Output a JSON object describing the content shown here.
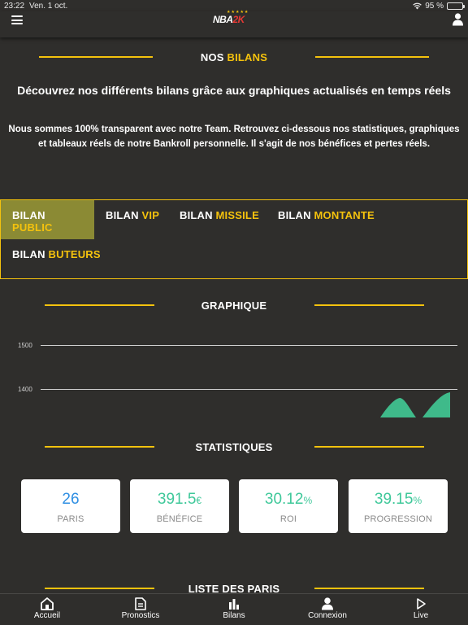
{
  "status_bar": {
    "time": "23:22",
    "date": "Ven. 1 oct.",
    "battery": "95 %",
    "battery_level": 0.95
  },
  "header": {
    "logo": {
      "text_white": "NBA",
      "text_red": "2K",
      "stars": "★★★★★"
    },
    "menu_icon": "hamburger-menu-icon",
    "user_icon": "user-icon"
  },
  "bilans_section": {
    "title_white": "NOS",
    "title_yellow": "BILANS",
    "heading": "Découvrez nos différents bilans grâce aux graphiques actualisés en temps réels",
    "text": "Nous sommes 100% transparent avec notre Team. Retrouvez ci-dessous nos statistiques, graphiques et tableaux réels de notre Bankroll personnelle.  Il s'agit de nos bénéfices et pertes réels."
  },
  "tabs": [
    {
      "prefix": "BILAN",
      "name": "PUBLIC",
      "active": true
    },
    {
      "prefix": "BILAN",
      "name": "VIP",
      "active": false
    },
    {
      "prefix": "BILAN",
      "name": "MISSILE",
      "active": false
    },
    {
      "prefix": "BILAN",
      "name": "MONTANTE",
      "active": false
    },
    {
      "prefix": "BILAN",
      "name": "BUTEURS",
      "active": false
    }
  ],
  "graph_section": {
    "title": "GRAPHIQUE",
    "y_ticks": [
      "1500",
      "1400"
    ]
  },
  "stats_section": {
    "title": "STATISTIQUES",
    "cards": [
      {
        "value": "26",
        "unit": "",
        "label": "PARIS",
        "color": "#2f8fe3"
      },
      {
        "value": "391.5",
        "unit": "€",
        "label": "BÉNÉFICE",
        "color": "#3fc89a"
      },
      {
        "value": "30.12",
        "unit": "%",
        "label": "ROI",
        "color": "#3fc89a"
      },
      {
        "value": "39.15",
        "unit": "%",
        "label": "PROGRESSION",
        "color": "#3fc89a"
      }
    ]
  },
  "list_section": {
    "title": "LISTE DES PARIS"
  },
  "bottom_nav": [
    {
      "label": "Accueil",
      "icon": "home-icon"
    },
    {
      "label": "Pronostics",
      "icon": "document-icon"
    },
    {
      "label": "Bilans",
      "icon": "bar-chart-icon"
    },
    {
      "label": "Connexion",
      "icon": "user-icon"
    },
    {
      "label": "Live",
      "icon": "play-icon"
    }
  ],
  "colors": {
    "background": "#2f2e2c",
    "accent": "#f4c20d",
    "active_tab": "#8b8a34",
    "graph_fill": "#3fba8a"
  }
}
